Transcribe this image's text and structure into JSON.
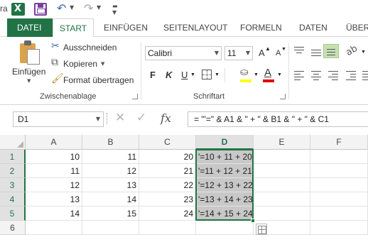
{
  "titlebar": {
    "cut_text": "ra"
  },
  "tabs": {
    "file": "DATEI",
    "start": "START",
    "insert": "EINFÜGEN",
    "layout": "SEITENLAYOUT",
    "formulas": "FORMELN",
    "data": "DATEN",
    "review": "ÜBERP"
  },
  "clipboard": {
    "paste": "Einfügen",
    "cut": "Ausschneiden",
    "copy": "Kopieren",
    "format_painter": "Format übertragen",
    "group_label": "Zwischenablage"
  },
  "font": {
    "name": "Calibri",
    "size": "11",
    "grow": "A",
    "shrink": "A",
    "bold": "F",
    "italic": "K",
    "underline": "U",
    "font_color_letter": "A",
    "group_label": "Schriftart"
  },
  "formula_bar": {
    "name_box": "D1",
    "cancel_glyph": "✕",
    "enter_glyph": "✓",
    "fx_glyph": "fx",
    "formula": "= \"'=\" & A1 & \" + \" & B1 & \" + \" & C1"
  },
  "sheet": {
    "columns": [
      "A",
      "B",
      "C",
      "D",
      "E",
      "F"
    ],
    "selected_column": "D",
    "rows": [
      {
        "num": "1",
        "a": "10",
        "b": "11",
        "c": "20",
        "d": "'=10 + 11 + 20"
      },
      {
        "num": "2",
        "a": "11",
        "b": "12",
        "c": "21",
        "d": "'=11 + 12 + 21"
      },
      {
        "num": "3",
        "a": "12",
        "b": "13",
        "c": "22",
        "d": "'=12 + 13 + 22"
      },
      {
        "num": "4",
        "a": "13",
        "b": "14",
        "c": "23",
        "d": "'=13 + 14 + 23"
      },
      {
        "num": "5",
        "a": "14",
        "b": "15",
        "c": "24",
        "d": "'=14 + 15 + 24"
      },
      {
        "num": "6",
        "a": "",
        "b": "",
        "c": "",
        "d": ""
      }
    ]
  },
  "colors": {
    "accent": "#217346",
    "selection": "#c8c8c8"
  }
}
